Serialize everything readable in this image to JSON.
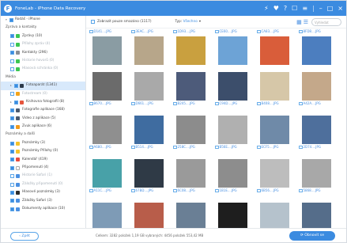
{
  "window": {
    "title": "FoneLab - iPhone Data Recovery"
  },
  "toolbar": {
    "checkbox_label": "Zobrazit pouze smazáno (1117)",
    "type_label": "Typ:",
    "type_value": "Všechno",
    "search_placeholder": "Vyhledat"
  },
  "sidebar": {
    "rows": [
      {
        "text": "Rodáš - iPhone",
        "kind": "device",
        "sel": false,
        "dim": false,
        "chk": true,
        "tw": "▾",
        "icon": ""
      },
      {
        "text": "Zpráva a kontakty",
        "kind": "head",
        "sel": false,
        "dim": false,
        "chk": false,
        "tw": "",
        "icon": ""
      },
      {
        "text": "Zprávy (10)",
        "kind": "item",
        "sel": false,
        "dim": false,
        "chk": true,
        "tw": "",
        "icon": "#3cc653"
      },
      {
        "text": "Přílohy zpráv (4)",
        "kind": "item",
        "sel": false,
        "dim": true,
        "chk": false,
        "tw": "",
        "icon": "#3cc653"
      },
      {
        "text": "Kontakty (296)",
        "kind": "item",
        "sel": false,
        "dim": false,
        "chk": true,
        "tw": "",
        "icon": "#8a8f96"
      },
      {
        "text": "Historie hovorů (0)",
        "kind": "item",
        "sel": false,
        "dim": true,
        "chk": false,
        "tw": "",
        "icon": "#3cc653"
      },
      {
        "text": "Hlasová schránka (0)",
        "kind": "item",
        "sel": false,
        "dim": true,
        "chk": false,
        "tw": "",
        "icon": "#3cc653"
      },
      {
        "text": "Média",
        "kind": "head",
        "sel": false,
        "dim": false,
        "chk": false,
        "tw": "",
        "icon": ""
      },
      {
        "text": "Fotoaparát (1341)",
        "kind": "item",
        "sel": true,
        "dim": false,
        "chk": true,
        "tw": "▸",
        "icon": "#2d3a4b"
      },
      {
        "text": "Fotostream (0)",
        "kind": "item",
        "sel": false,
        "dim": true,
        "chk": false,
        "tw": "",
        "icon": "#f3a41b"
      },
      {
        "text": "Knihovna fotografií (8)",
        "kind": "item",
        "sel": false,
        "dim": false,
        "chk": true,
        "tw": "▸",
        "icon": "#e6553d"
      },
      {
        "text": "Fotografie aplikace (168)",
        "kind": "item",
        "sel": false,
        "dim": false,
        "chk": true,
        "tw": "",
        "icon": "#4b5a6e"
      },
      {
        "text": "Video z aplikace (5)",
        "kind": "item",
        "sel": false,
        "dim": false,
        "chk": true,
        "tw": "",
        "icon": "#4b5a6e"
      },
      {
        "text": "Zvuk aplikace (6)",
        "kind": "item",
        "sel": false,
        "dim": false,
        "chk": true,
        "tw": "",
        "icon": "#f29a1b"
      },
      {
        "text": "Poznámky a další",
        "kind": "head",
        "sel": false,
        "dim": false,
        "chk": false,
        "tw": "",
        "icon": ""
      },
      {
        "text": "Poznámky (3)",
        "kind": "item",
        "sel": false,
        "dim": false,
        "chk": true,
        "tw": "",
        "icon": "#f5c32c"
      },
      {
        "text": "Poznámky Přílohy (0)",
        "kind": "item",
        "sel": false,
        "dim": false,
        "chk": true,
        "tw": "",
        "icon": "#f5c32c"
      },
      {
        "text": "Kalendář (419)",
        "kind": "item",
        "sel": false,
        "dim": false,
        "chk": true,
        "tw": "",
        "icon": "#e84c3d"
      },
      {
        "text": "Připomenutí (4)",
        "kind": "item",
        "sel": false,
        "dim": false,
        "chk": true,
        "tw": "",
        "icon": "#ffffff"
      },
      {
        "text": "Historie Safari (1)",
        "kind": "item",
        "sel": false,
        "dim": true,
        "chk": false,
        "tw": "",
        "icon": "#4a90e2"
      },
      {
        "text": "Záložky připomenutí (0)",
        "kind": "item",
        "sel": false,
        "dim": true,
        "chk": false,
        "tw": "",
        "icon": "#4a90e2"
      },
      {
        "text": "Hlasové poznámky (3)",
        "kind": "item",
        "sel": false,
        "dim": false,
        "chk": true,
        "tw": "",
        "icon": "#2d2d2d"
      },
      {
        "text": "Záložky Safari (3)",
        "kind": "item",
        "sel": false,
        "dim": false,
        "chk": true,
        "tw": "",
        "icon": "#4a90e2"
      },
      {
        "text": "Dokumenty aplikace (10)",
        "kind": "item",
        "sel": false,
        "dim": false,
        "chk": true,
        "tw": "",
        "icon": "#4a90e2"
      }
    ]
  },
  "grid": {
    "rows": [
      [
        {
          "name": "D141....JPG",
          "color": "#8a9ca3"
        },
        {
          "name": "3EAC....JPG",
          "color": "#b7a68a"
        },
        {
          "name": "1D93....JPG",
          "color": "#c9a03f"
        },
        {
          "name": "CE60....JPG",
          "color": "#6da3d6"
        },
        {
          "name": "CA83....JPG",
          "color": "#d95d3a"
        },
        {
          "name": "8FD8....JPG",
          "color": "#4c7ebf"
        }
      ],
      [
        {
          "name": "B670....JPG",
          "color": "#6b6b6b"
        },
        {
          "name": "D661....JPG",
          "color": "#a9a9a9"
        },
        {
          "name": "B245....JPG",
          "color": "#4d5b7a"
        },
        {
          "name": "C94D....JPG",
          "color": "#3c4e6b"
        },
        {
          "name": "B408....JPG",
          "color": "#d6c7a8"
        },
        {
          "name": "A42A....JPG",
          "color": "#c4a88a"
        }
      ],
      [
        {
          "name": "A680....JPG",
          "color": "#8f8f8f"
        },
        {
          "name": "B514....JPG",
          "color": "#3f6ca0"
        },
        {
          "name": "258C....JPG",
          "color": "#8c8c8c"
        },
        {
          "name": "B56E....JPG",
          "color": "#b0b0b0"
        },
        {
          "name": "ECF5....JPG",
          "color": "#6f8aa8"
        },
        {
          "name": "2D74....JPG",
          "color": "#4e6f9c"
        }
      ],
      [
        {
          "name": "A11C....JPG",
          "color": "#48a1a8"
        },
        {
          "name": "67BD....JPG",
          "color": "#2f3a46"
        },
        {
          "name": "6C08....JPG",
          "color": "#9a9a9a"
        },
        {
          "name": "1B1E....JPG",
          "color": "#8d8d8d"
        },
        {
          "name": "6B56....JPG",
          "color": "#bdbdbd"
        },
        {
          "name": "5868....JPG",
          "color": "#a8a8a8"
        }
      ],
      [
        {
          "name": "9AE3....JPG",
          "color": "#7e9bb6"
        },
        {
          "name": "AA18....JPG",
          "color": "#b85d4a"
        },
        {
          "name": "2CC4....JPG",
          "color": "#6a7f95"
        },
        {
          "name": "4A13....JPG",
          "color": "#1e1e1e"
        },
        {
          "name": "7EFA....JPG",
          "color": "#b5c2cc"
        },
        {
          "name": "3B09....JPG",
          "color": "#556d8a"
        }
      ]
    ]
  },
  "footer": {
    "back_label": "Zpět",
    "stats": "Celkem: 3282 položek 1,19 GB   vybraných: 4456 položek 553,42 MB",
    "recover_label": "Obnovit se"
  }
}
